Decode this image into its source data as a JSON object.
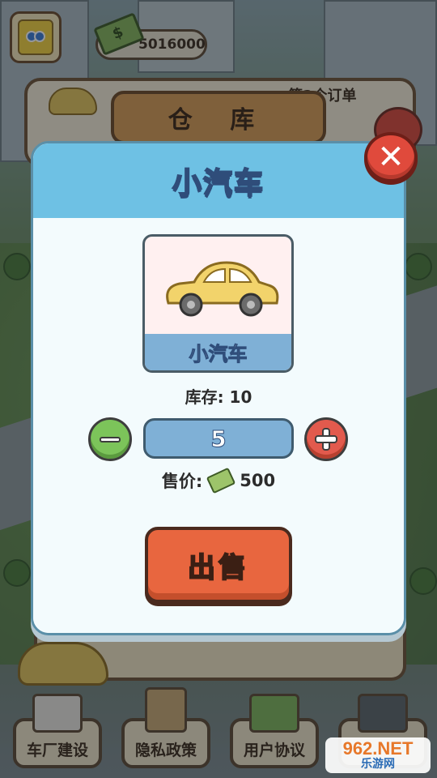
{
  "hud": {
    "money": "5016000",
    "money_icon": "cash-stack-icon",
    "avatar_icon": "player-avatar-icon"
  },
  "warehouse": {
    "title": "仓 库",
    "order_text": "第2个订单"
  },
  "modal": {
    "title": "小汽车",
    "item_name": "小汽车",
    "item_icon": "yellow-car-icon",
    "stock_label": "库存: 10",
    "quantity": "5",
    "price_label": "售价:",
    "price_value": "500",
    "sell_label": "出售",
    "close_icon": "close-x-icon"
  },
  "nav": {
    "items": [
      {
        "label": "车厂建设",
        "icon": "garage-icon"
      },
      {
        "label": "隐私政策",
        "icon": "document-icon"
      },
      {
        "label": "用户协议",
        "icon": "money-bag-icon"
      },
      {
        "label": "",
        "icon": "gate-icon"
      }
    ]
  },
  "watermark": {
    "logo": "962.NET",
    "sub": "乐游网"
  },
  "colors": {
    "modal_header": "#6ec1e4",
    "close_button": "#e04a3c",
    "sell_button": "#e8663f",
    "minus_button": "#7cc45a",
    "plus_button": "#e25a4d",
    "qty_field": "#7fb0d6"
  }
}
